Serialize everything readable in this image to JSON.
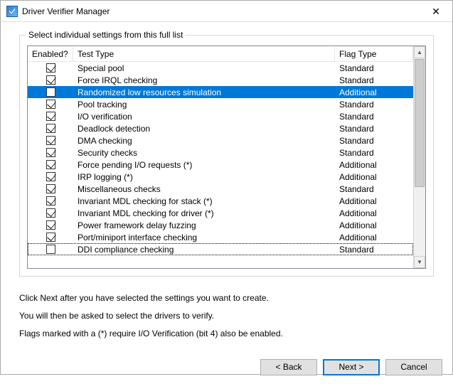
{
  "window": {
    "title": "Driver Verifier Manager"
  },
  "group": {
    "label": "Select individual settings from this full list"
  },
  "columns": {
    "enabled": "Enabled?",
    "test_type": "Test Type",
    "flag_type": "Flag Type"
  },
  "rows": [
    {
      "checked": true,
      "test": "Special pool",
      "flag": "Standard",
      "selected": false,
      "focused": false
    },
    {
      "checked": true,
      "test": "Force IRQL checking",
      "flag": "Standard",
      "selected": false,
      "focused": false
    },
    {
      "checked": false,
      "test": "Randomized low resources simulation",
      "flag": "Additional",
      "selected": true,
      "focused": false
    },
    {
      "checked": true,
      "test": "Pool tracking",
      "flag": "Standard",
      "selected": false,
      "focused": false
    },
    {
      "checked": true,
      "test": "I/O verification",
      "flag": "Standard",
      "selected": false,
      "focused": false
    },
    {
      "checked": true,
      "test": "Deadlock detection",
      "flag": "Standard",
      "selected": false,
      "focused": false
    },
    {
      "checked": true,
      "test": "DMA checking",
      "flag": "Standard",
      "selected": false,
      "focused": false
    },
    {
      "checked": true,
      "test": "Security checks",
      "flag": "Standard",
      "selected": false,
      "focused": false
    },
    {
      "checked": true,
      "test": "Force pending I/O requests (*)",
      "flag": "Additional",
      "selected": false,
      "focused": false
    },
    {
      "checked": true,
      "test": "IRP logging (*)",
      "flag": "Additional",
      "selected": false,
      "focused": false
    },
    {
      "checked": true,
      "test": "Miscellaneous checks",
      "flag": "Standard",
      "selected": false,
      "focused": false
    },
    {
      "checked": true,
      "test": "Invariant MDL checking for stack (*)",
      "flag": "Additional",
      "selected": false,
      "focused": false
    },
    {
      "checked": true,
      "test": "Invariant MDL checking for driver (*)",
      "flag": "Additional",
      "selected": false,
      "focused": false
    },
    {
      "checked": true,
      "test": "Power framework delay fuzzing",
      "flag": "Additional",
      "selected": false,
      "focused": false
    },
    {
      "checked": true,
      "test": "Port/miniport interface checking",
      "flag": "Additional",
      "selected": false,
      "focused": false
    },
    {
      "checked": false,
      "test": "DDI compliance checking",
      "flag": "Standard",
      "selected": false,
      "focused": true
    }
  ],
  "instructions": {
    "line1": "Click Next after you have selected the settings you want to create.",
    "line2": "You will then be asked to select the drivers to verify.",
    "line3": "Flags marked with a (*) require I/O Verification (bit 4) also be enabled."
  },
  "buttons": {
    "back": "< Back",
    "next": "Next >",
    "cancel": "Cancel"
  }
}
